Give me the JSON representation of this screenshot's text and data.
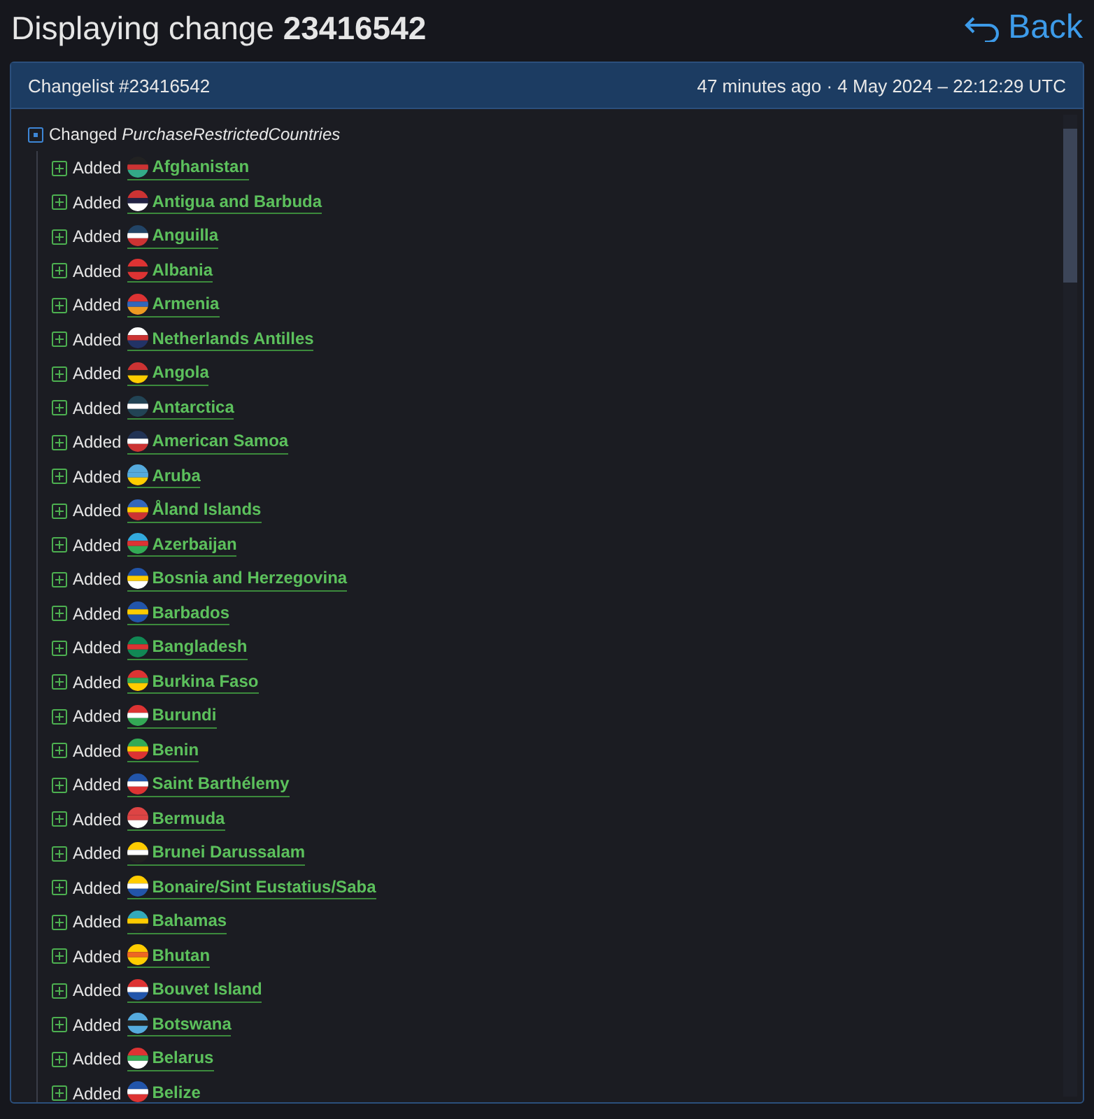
{
  "page": {
    "title": "Displaying change **23416542**",
    "back": "Back"
  },
  "changelist": {
    "title": "Changelist #23416542",
    "time": "47 minutes ago · 4 May 2024 – 22:12:29 UTC",
    "change": {
      "action": "Changed",
      "field": "PurchaseRestrictedCountries",
      "expanded": true,
      "children": [
        {
          "action": "Added",
          "country": "Afghanistan"
        },
        {
          "action": "Added",
          "country": "Antigua and Barbuda"
        },
        {
          "action": "Added",
          "country": "Anguilla"
        },
        {
          "action": "Added",
          "country": "Albania"
        },
        {
          "action": "Added",
          "country": "Armenia"
        },
        {
          "action": "Added",
          "country": "Netherlands Antilles"
        },
        {
          "action": "Added",
          "country": "Angola"
        },
        {
          "action": "Added",
          "country": "Antarctica"
        },
        {
          "action": "Added",
          "country": "American Samoa"
        },
        {
          "action": "Added",
          "country": "Aruba"
        },
        {
          "action": "Added",
          "country": "Åland Islands"
        },
        {
          "action": "Added",
          "country": "Azerbaijan"
        },
        {
          "action": "Added",
          "country": "Bosnia and Herzegovina"
        },
        {
          "action": "Added",
          "country": "Barbados"
        },
        {
          "action": "Added",
          "country": "Bangladesh"
        },
        {
          "action": "Added",
          "country": "Burkina Faso"
        },
        {
          "action": "Added",
          "country": "Burundi"
        },
        {
          "action": "Added",
          "country": "Benin"
        },
        {
          "action": "Added",
          "country": "Saint Barthélemy"
        },
        {
          "action": "Added",
          "country": "Bermuda"
        },
        {
          "action": "Added",
          "country": "Brunei Darussalam"
        },
        {
          "action": "Added",
          "country": "Bonaire/Sint Eustatius/Saba"
        },
        {
          "action": "Added",
          "country": "Bahamas"
        },
        {
          "action": "Added",
          "country": "Bhutan"
        },
        {
          "action": "Added",
          "country": "Bouvet Island"
        },
        {
          "action": "Added",
          "country": "Botswana"
        },
        {
          "action": "Added",
          "country": "Belarus"
        },
        {
          "action": "Added",
          "country": "Belize"
        }
      ]
    }
  }
}
